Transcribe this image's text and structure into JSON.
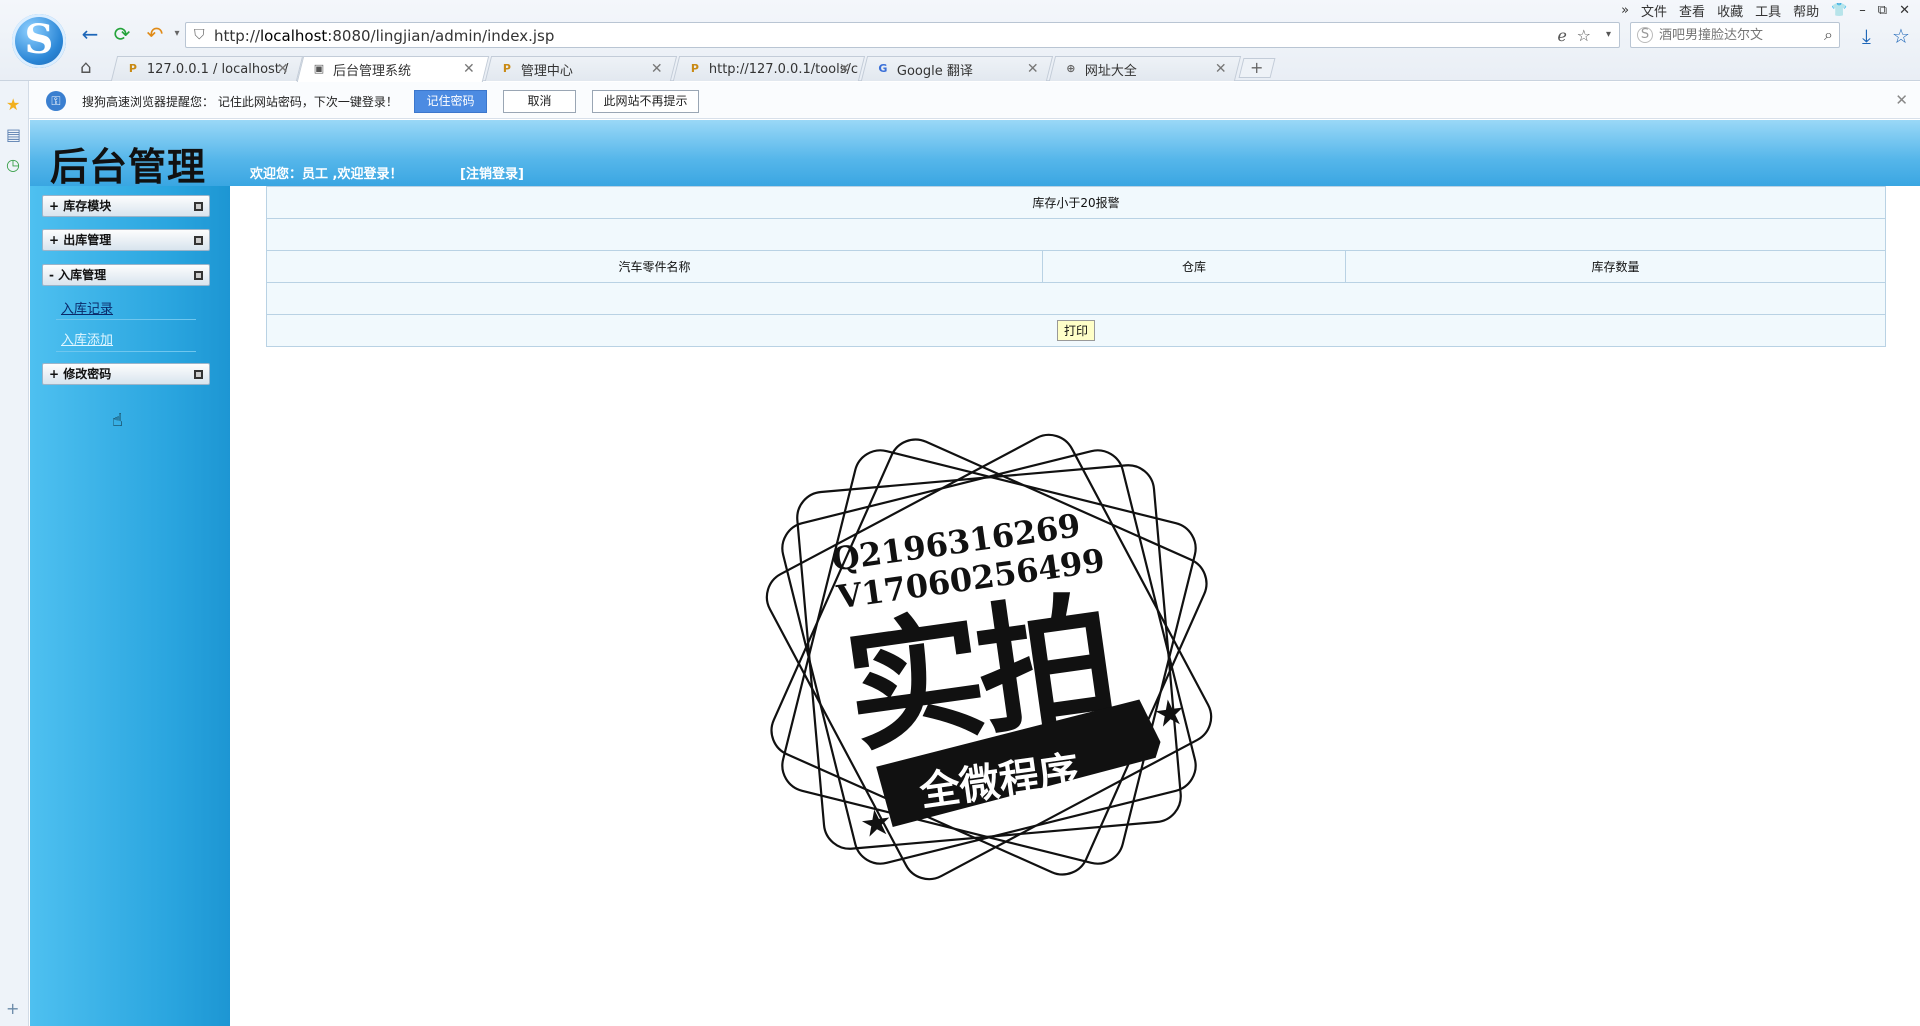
{
  "browser": {
    "url_prefix": "http://",
    "url_host": "localhost",
    "url_rest": ":8080/lingjian/admin/index.jsp",
    "search_placeholder": "酒吧男撞脸达尔文",
    "menu": [
      "文件",
      "查看",
      "收藏",
      "工具",
      "帮助"
    ],
    "tabs": [
      {
        "label": "127.0.0.1 / localhost /",
        "favicon": "PMA"
      },
      {
        "label": "后台管理系统",
        "favicon": "page"
      },
      {
        "label": "管理中心",
        "favicon": "PMA"
      },
      {
        "label": "http://127.0.0.1/tools/c",
        "favicon": "PMA"
      },
      {
        "label": "Google 翻译",
        "favicon": "G"
      },
      {
        "label": "网址大全",
        "favicon": "globe"
      }
    ],
    "new_tab": "+"
  },
  "password_bar": {
    "message": "搜狗高速浏览器提醒您： 记住此网站密码，下次一键登录！",
    "remember_label": "记住密码",
    "cancel_label": "取消",
    "never_label": "此网站不再提示"
  },
  "header": {
    "title": "后台管理",
    "welcome_prefix": "欢迎您：",
    "user": "员工",
    "welcome_suffix": "  ,欢迎登录！",
    "logout": "[注销登录]"
  },
  "sidebar": {
    "groups": [
      {
        "label": "+ 库存模块"
      },
      {
        "label": "+ 出库管理"
      },
      {
        "label": "- 入库管理",
        "items": [
          "入库记录",
          "入库添加"
        ]
      },
      {
        "label": "+ 修改密码"
      }
    ]
  },
  "main": {
    "caption": "库存小于20报警",
    "columns": [
      "汽车零件名称",
      "仓库",
      "库存数量"
    ],
    "print_label": "打印"
  },
  "stamp": {
    "line1": "Q2196316269",
    "line2": "V17060256499",
    "big": "实拍",
    "ribbon": "全微程序"
  },
  "colors": {
    "header_top": "#9ad8f7",
    "header_bottom": "#3aa6e2",
    "sidebar": "#2aa5df",
    "table_bg": "#f1f9fd",
    "table_border": "#b9d2e4"
  }
}
